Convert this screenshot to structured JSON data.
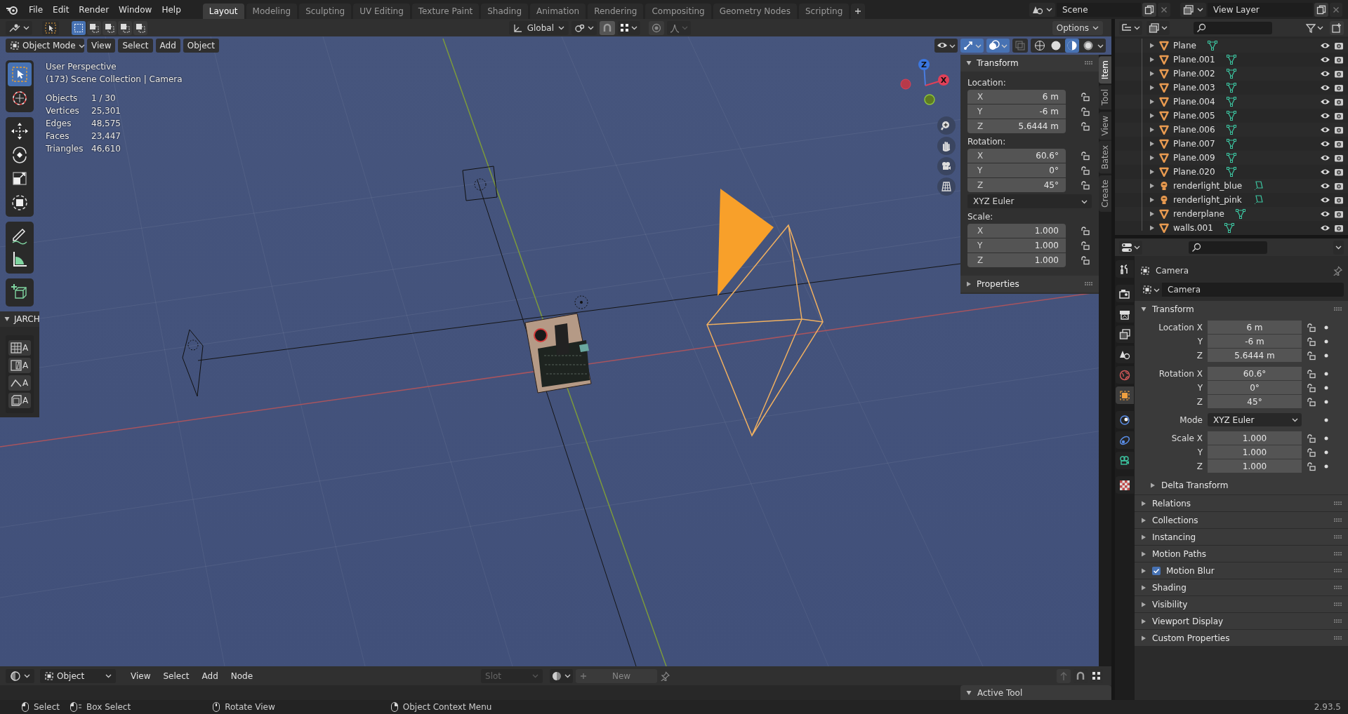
{
  "top_bar": {
    "menus": [
      "File",
      "Edit",
      "Render",
      "Window",
      "Help"
    ],
    "workspaces": [
      {
        "label": "Layout",
        "selected": true
      },
      {
        "label": "Modeling",
        "selected": false
      },
      {
        "label": "Sculpting",
        "selected": false
      },
      {
        "label": "UV Editing",
        "selected": false
      },
      {
        "label": "Texture Paint",
        "selected": false
      },
      {
        "label": "Shading",
        "selected": false
      },
      {
        "label": "Animation",
        "selected": false
      },
      {
        "label": "Rendering",
        "selected": false
      },
      {
        "label": "Compositing",
        "selected": false
      },
      {
        "label": "Geometry Nodes",
        "selected": false
      },
      {
        "label": "Scripting",
        "selected": false
      }
    ],
    "scene": "Scene",
    "view_layer": "View Layer"
  },
  "tool_header": {
    "orientation": "Global",
    "options": "Options"
  },
  "viewport": {
    "mode": "Object Mode",
    "menus": [
      "View",
      "Select",
      "Add",
      "Object"
    ],
    "tool_groups": [
      [
        {
          "kind": "select_box",
          "selected": true
        },
        {
          "kind": "cursor",
          "selected": false
        }
      ],
      [
        {
          "kind": "move",
          "selected": false
        },
        {
          "kind": "rotate",
          "selected": false
        },
        {
          "kind": "scale",
          "selected": false
        },
        {
          "kind": "transform",
          "selected": false
        }
      ],
      [
        {
          "kind": "annotate",
          "selected": false
        },
        {
          "kind": "measure",
          "selected": false
        }
      ],
      [
        {
          "kind": "add_cube",
          "selected": false
        }
      ]
    ],
    "view_name": "User Perspective",
    "context": "(173) Scene Collection | Camera",
    "stats": [
      {
        "label": "Objects",
        "value": "1 / 30"
      },
      {
        "label": "Vertices",
        "value": "25,301"
      },
      {
        "label": "Edges",
        "value": "48,575"
      },
      {
        "label": "Faces",
        "value": "23,447"
      },
      {
        "label": "Triangles",
        "value": "46,610"
      }
    ],
    "jarch": {
      "title": "JARCH",
      "buttons": [
        {
          "kind": "grid",
          "label": "A"
        },
        {
          "kind": "window",
          "label": "A"
        },
        {
          "kind": "roof",
          "label": "A"
        },
        {
          "kind": "box",
          "label": "A"
        }
      ]
    },
    "gizmo": {
      "z_label": "Z",
      "x_label": "X"
    }
  },
  "sidebar": {
    "tabs": [
      {
        "label": "Item",
        "selected": true
      },
      {
        "label": "Tool",
        "selected": false
      },
      {
        "label": "View",
        "selected": false
      },
      {
        "label": "Batex",
        "selected": false
      },
      {
        "label": "Create",
        "selected": false
      }
    ],
    "panel_title": "Transform",
    "groups": [
      {
        "label": "Location:",
        "fields": [
          {
            "axis": "X",
            "value": "6 m"
          },
          {
            "axis": "Y",
            "value": "-6 m"
          },
          {
            "axis": "Z",
            "value": "5.6444 m"
          }
        ]
      },
      {
        "label": "Rotation:",
        "fields": [
          {
            "axis": "X",
            "value": "60.6°"
          },
          {
            "axis": "Y",
            "value": "0°"
          },
          {
            "axis": "Z",
            "value": "45°"
          }
        ]
      },
      {
        "label": "Scale:",
        "fields": [
          {
            "axis": "X",
            "value": "1.000"
          },
          {
            "axis": "Y",
            "value": "1.000"
          },
          {
            "axis": "Z",
            "value": "1.000"
          }
        ]
      }
    ],
    "rotation_mode": "XYZ Euler",
    "collapsed_panel": "Properties"
  },
  "outliner": {
    "rows": [
      {
        "name": "Plane",
        "kind": "mesh"
      },
      {
        "name": "Plane.001",
        "kind": "mesh"
      },
      {
        "name": "Plane.002",
        "kind": "mesh"
      },
      {
        "name": "Plane.003",
        "kind": "mesh"
      },
      {
        "name": "Plane.004",
        "kind": "mesh"
      },
      {
        "name": "Plane.005",
        "kind": "mesh"
      },
      {
        "name": "Plane.006",
        "kind": "mesh"
      },
      {
        "name": "Plane.007",
        "kind": "mesh"
      },
      {
        "name": "Plane.009",
        "kind": "mesh"
      },
      {
        "name": "Plane.020",
        "kind": "mesh"
      },
      {
        "name": "renderlight_blue",
        "kind": "light"
      },
      {
        "name": "renderlight_pink",
        "kind": "light"
      },
      {
        "name": "renderplane",
        "kind": "mesh"
      },
      {
        "name": "walls.001",
        "kind": "mesh"
      }
    ]
  },
  "properties": {
    "tabs": [
      {
        "kind": "tool",
        "selected": false
      },
      {
        "kind": "render",
        "selected": false
      },
      {
        "kind": "output",
        "selected": false
      },
      {
        "kind": "view_layer",
        "selected": false
      },
      {
        "kind": "scene",
        "selected": false
      },
      {
        "kind": "world",
        "selected": false
      },
      {
        "kind": "object",
        "selected": true
      },
      {
        "kind": "physics",
        "selected": false
      },
      {
        "kind": "constraints",
        "selected": false
      },
      {
        "kind": "data",
        "selected": false
      },
      {
        "kind": "texture",
        "selected": false
      }
    ],
    "object_name": "Camera",
    "datablock": "Camera",
    "panel_title": "Transform",
    "groups": [
      [
        {
          "label": "Location X",
          "value": "6 m",
          "kind": "number"
        },
        {
          "label": "Y",
          "value": "-6 m",
          "kind": "number"
        },
        {
          "label": "Z",
          "value": "5.6444 m",
          "kind": "number"
        }
      ],
      [
        {
          "label": "Rotation X",
          "value": "60.6°",
          "kind": "number"
        },
        {
          "label": "Y",
          "value": "0°",
          "kind": "number"
        },
        {
          "label": "Z",
          "value": "45°",
          "kind": "number"
        }
      ],
      [
        {
          "label": "Mode",
          "value": "XYZ Euler",
          "kind": "menu"
        }
      ],
      [
        {
          "label": "Scale X",
          "value": "1.000",
          "kind": "number"
        },
        {
          "label": "Y",
          "value": "1.000",
          "kind": "number"
        },
        {
          "label": "Z",
          "value": "1.000",
          "kind": "number"
        }
      ]
    ],
    "subpanel": "Delta Transform",
    "panels": [
      {
        "title": "Relations",
        "kind": "plain"
      },
      {
        "title": "Collections",
        "kind": "plain"
      },
      {
        "title": "Instancing",
        "kind": "plain"
      },
      {
        "title": "Motion Paths",
        "kind": "plain"
      },
      {
        "title": "Motion Blur",
        "kind": "checkbox",
        "checked": true
      },
      {
        "title": "Shading",
        "kind": "plain"
      },
      {
        "title": "Visibility",
        "kind": "plain"
      },
      {
        "title": "Viewport Display",
        "kind": "plain"
      },
      {
        "title": "Custom Properties",
        "kind": "plain"
      }
    ]
  },
  "node_editor": {
    "object": "Object",
    "menus": [
      "View",
      "Select",
      "Add",
      "Node"
    ],
    "slot": "Slot",
    "new": "New",
    "active_tool": "Active Tool"
  },
  "status_bar": {
    "hints": [
      {
        "kind": "lmb",
        "label": "Select"
      },
      {
        "kind": "lmb_drag",
        "label": "Box Select"
      },
      {
        "kind": "mmb",
        "label": "Rotate View"
      },
      {
        "kind": "rmb",
        "label": "Object Context Menu"
      }
    ],
    "version": "2.93.5"
  }
}
